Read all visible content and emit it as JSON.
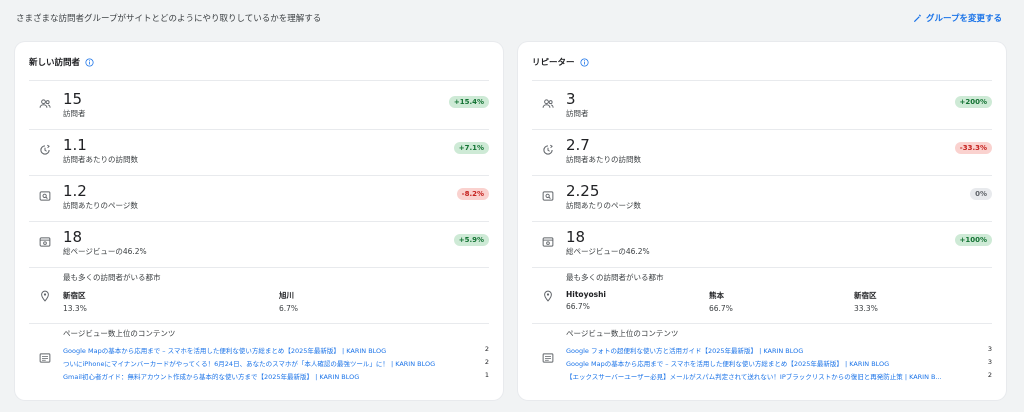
{
  "header": {
    "subtitle": "さまざまな訪問者グループがサイトとどのようにやり取りしているかを理解する",
    "change_group": "グループを変更する"
  },
  "colors": {
    "accent": "#1a73e8",
    "badge_up_bg": "#ceead6",
    "badge_up_fg": "#137333",
    "badge_down_bg": "#fad2cf",
    "badge_down_fg": "#c5221f",
    "badge_flat_bg": "#e8eaed"
  },
  "new": {
    "title": "新しい訪問者",
    "metrics": [
      {
        "icon": "people-icon",
        "value": "15",
        "label": "訪問者",
        "change": "+15.4%"
      },
      {
        "icon": "history-icon",
        "value": "1.1",
        "label": "訪問者あたりの訪問数",
        "change": "+7.1%"
      },
      {
        "icon": "page-search-icon",
        "value": "1.2",
        "label": "訪問あたりのページ数",
        "change": "-8.2%"
      },
      {
        "icon": "pageview-icon",
        "value": "18",
        "label": "総ページビューの46.2%",
        "change": "+5.9%"
      }
    ],
    "cities_title": "最も多くの訪問者がいる都市",
    "cities": [
      {
        "name": "新宿区",
        "pct": "13.3%"
      },
      {
        "name": "旭川",
        "pct": "6.7%"
      }
    ],
    "pages_title": "ページビュー数上位のコンテンツ",
    "pages": [
      {
        "title": "Google Mapの基本から応用まで – スマホを活用した便利な使い方総まとめ【2025年最新版】 | KARIN BLOG",
        "count": "2"
      },
      {
        "title": "ついにiPhoneにマイナンバーカードがやってくる！6月24日、あなたのスマホが「本人確認の最強ツール」に！ | KARIN BLOG",
        "count": "2"
      },
      {
        "title": "Gmail初心者ガイド：無料アカウント作成から基本的な使い方まで【2025年最新版】 | KARIN BLOG",
        "count": "1"
      }
    ]
  },
  "returning": {
    "title": "リピーター",
    "metrics": [
      {
        "icon": "people-icon",
        "value": "3",
        "label": "訪問者",
        "change": "+200%"
      },
      {
        "icon": "history-icon",
        "value": "2.7",
        "label": "訪問者あたりの訪問数",
        "change": "-33.3%"
      },
      {
        "icon": "page-search-icon",
        "value": "2.25",
        "label": "訪問あたりのページ数",
        "change": "0%"
      },
      {
        "icon": "pageview-icon",
        "value": "18",
        "label": "総ページビューの46.2%",
        "change": "+100%"
      }
    ],
    "cities_title": "最も多くの訪問者がいる都市",
    "cities": [
      {
        "name": "Hitoyoshi",
        "pct": "66.7%"
      },
      {
        "name": "熊本",
        "pct": "66.7%"
      },
      {
        "name": "新宿区",
        "pct": "33.3%"
      }
    ],
    "pages_title": "ページビュー数上位のコンテンツ",
    "pages": [
      {
        "title": "Google フォトの超便利な使い方と活用ガイド【2025年最新版】 | KARIN BLOG",
        "count": "3"
      },
      {
        "title": "Google Mapの基本から応用まで – スマホを活用した便利な使い方総まとめ【2025年最新版】 | KARIN BLOG",
        "count": "3"
      },
      {
        "title": "【エックスサーバーユーザー必見】メールがスパム判定されて送れない！IPブラックリストからの復旧と再発防止策 | KARIN B...",
        "count": "2"
      }
    ]
  }
}
